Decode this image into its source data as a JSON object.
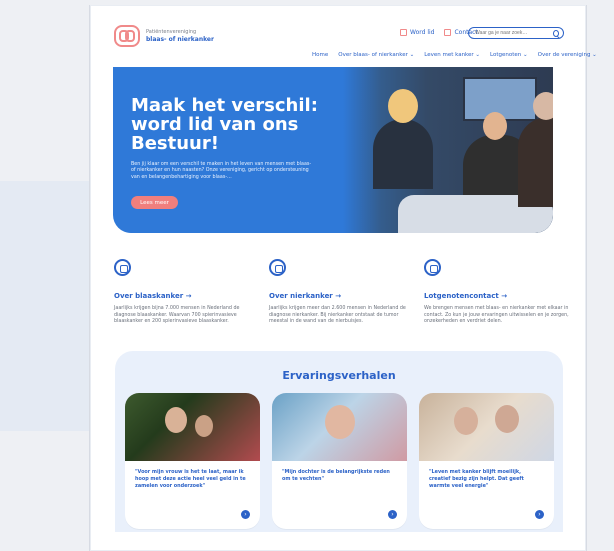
{
  "header": {
    "logo_line1": "Patiëntenvereniging",
    "logo_line2": "blaas- of nierkanker",
    "util_links": [
      "Word lid",
      "Contact"
    ],
    "search_placeholder": "Waar ga je naar zoek…"
  },
  "nav": {
    "items": [
      "Home",
      "Over blaas- of nierkanker ⌄",
      "Leven met kanker ⌄",
      "Lotgenoten ⌄",
      "Over de vereniging ⌄"
    ]
  },
  "hero": {
    "title": "Maak het verschil: word lid van ons Bestuur!",
    "body": "Ben jij klaar om een verschil te maken in het leven van mensen met blaas- of nierkanker en hun naasten? Onze vereniging, gericht op ondersteuning van en belangenbehartiging voor blaas-…",
    "cta": "Lees meer"
  },
  "features": [
    {
      "icon": "bladder-icon",
      "title": "Over blaaskanker →",
      "body": "Jaarlijks krijgen bijna 7.000 mensen in Nederland de diagnose blaaskanker. Waarvan 700 spierinvasieve blaaskanker en 200 spierinvasieve blaaskanker."
    },
    {
      "icon": "kidney-icon",
      "title": "Over nierkanker →",
      "body": "Jaarlijks krijgen meer dan 2.600 mensen in Nederland de diagnose nierkanker. Bij nierkanker ontstaat de tumor meestal in de wand van de nierbuisjes."
    },
    {
      "icon": "community-icon",
      "title": "Lotgenotencontact →",
      "body": "We brengen mensen met blaas- en nierkanker met elkaar in contact. Zo kun je jouw ervaringen uitwisselen en je zorgen, onzekerheden en verdriet delen."
    }
  ],
  "stories": {
    "title": "Ervaringsverhalen",
    "cards": [
      {
        "quote": "\"Voor mijn vrouw is het te laat, maar ik hoop met deze actie heel veel geld in te zamelen voor onderzoek\""
      },
      {
        "quote": "\"Mijn dochter is de belangrijkste reden om te vechten\""
      },
      {
        "quote": "\"Leven met kanker blijft moeilijk, creatief bezig zijn helpt. Dat geeft warmte veel energie\""
      }
    ]
  },
  "colors": {
    "primary": "#2c62c7",
    "accent": "#f07f7d",
    "hero_blue": "#2f79d8",
    "soft_blue": "#e9f0fb"
  }
}
